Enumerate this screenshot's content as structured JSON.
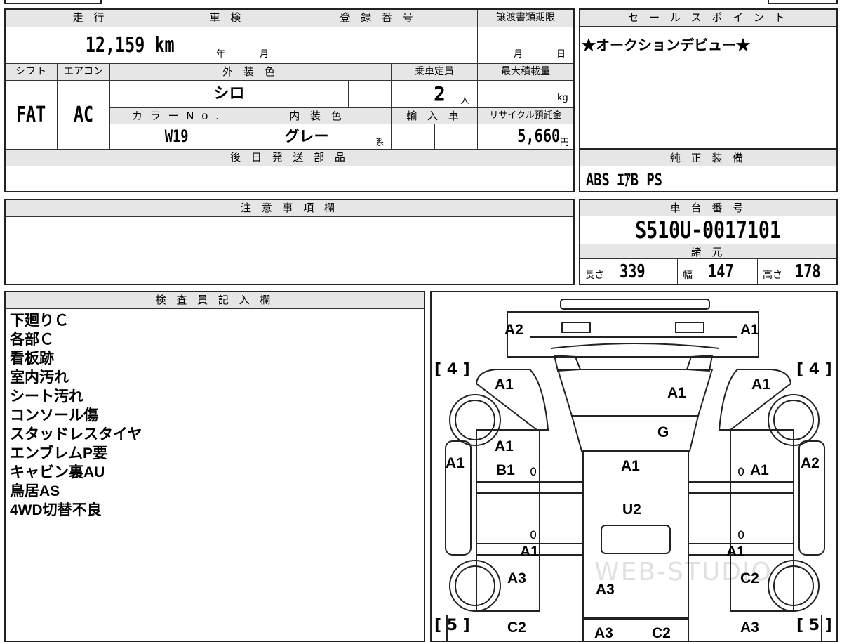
{
  "headers": {
    "mileage": "走 行",
    "inspection": "車 検",
    "registration": "登 録 番 号",
    "transfer_deadline": "譲渡書類期限",
    "shift": "シフト",
    "aircon": "エアコン",
    "exterior_color": "外 装 色",
    "capacity": "乗車定員",
    "max_load": "最大積載量",
    "color_no": "カ ラ ー N o .",
    "interior_color": "内 装 色",
    "import": "輸 入 車",
    "recycle_fee": "リサイクル預託金",
    "later_parts": "後 日 発 送 部 品",
    "sales_point": "セ ー ル ス ポ イ ン ト",
    "genuine_equipment": "純 正 装 備",
    "notes": "注 意 事 項 欄",
    "chassis_no": "車 台 番 号",
    "specs": "諸 元",
    "inspector": "検 査 員 記 入 欄"
  },
  "vehicle": {
    "mileage": "12,159 km",
    "inspection_year_unit": "年",
    "inspection_month_unit": "月",
    "deadline_month_unit": "月",
    "deadline_day_unit": "日",
    "shift": "FAT",
    "aircon": "AC",
    "exterior_color": "シロ",
    "capacity": "2",
    "capacity_unit": "人",
    "load_unit": "kg",
    "color_no": "W19",
    "interior_color": "グレー",
    "interior_color_suffix": "系",
    "recycle_fee": "5,660",
    "recycle_fee_unit": "円",
    "chassis_no": "S510U-0017101"
  },
  "sales_point": "★オークションデビュー★",
  "genuine_equipment": "ABS ｴｱB PS",
  "specs": {
    "length_label": "長さ",
    "length": "339",
    "width_label": "幅",
    "width": "147",
    "height_label": "高さ",
    "height": "178"
  },
  "inspector_notes": [
    "下廻りＣ",
    "各部Ｃ",
    "看板跡",
    "室内汚れ",
    "シート汚れ",
    "コンソール傷",
    "スタッドレスタイヤ",
    "エンブレムP要",
    "キャビン裏AU",
    "鳥居AS",
    "4WD切替不良"
  ],
  "diagram": {
    "tire_front_left": "[ 4 ]",
    "tire_front_right": "[ 4 ]",
    "tire_rear_left": "[ 5 ]",
    "tire_rear_right": "[ 5 ]",
    "watermark": "WEB-STUDIO",
    "marks": [
      "A2",
      "A1",
      "A1",
      "A1",
      "A1",
      "G",
      "A1",
      "B1",
      "A1",
      "A1",
      "A1",
      "A2",
      "0",
      "0",
      "U2",
      "0",
      "0",
      "A1",
      "A1",
      "A3",
      "C2",
      "A3",
      "C2",
      "A3",
      "C2",
      "A3"
    ]
  }
}
